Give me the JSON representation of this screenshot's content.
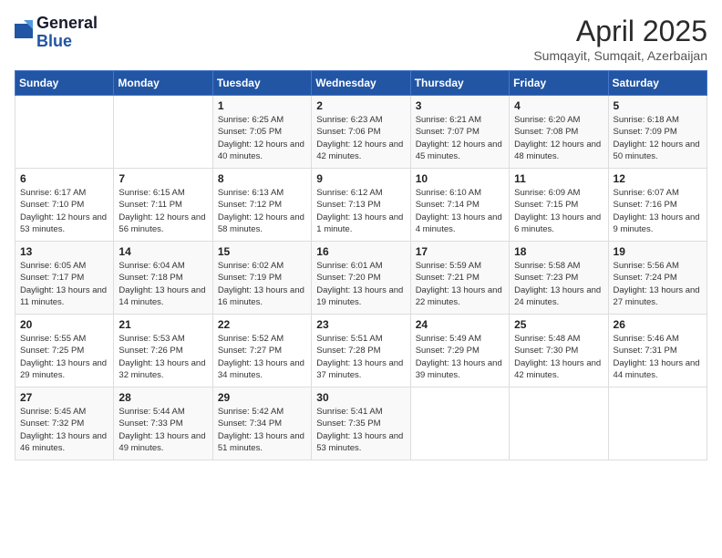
{
  "logo": {
    "general": "General",
    "blue": "Blue"
  },
  "title": "April 2025",
  "subtitle": "Sumqayit, Sumqait, Azerbaijan",
  "headers": [
    "Sunday",
    "Monday",
    "Tuesday",
    "Wednesday",
    "Thursday",
    "Friday",
    "Saturday"
  ],
  "weeks": [
    [
      {
        "day": "",
        "info": ""
      },
      {
        "day": "",
        "info": ""
      },
      {
        "day": "1",
        "info": "Sunrise: 6:25 AM\nSunset: 7:05 PM\nDaylight: 12 hours and 40 minutes."
      },
      {
        "day": "2",
        "info": "Sunrise: 6:23 AM\nSunset: 7:06 PM\nDaylight: 12 hours and 42 minutes."
      },
      {
        "day": "3",
        "info": "Sunrise: 6:21 AM\nSunset: 7:07 PM\nDaylight: 12 hours and 45 minutes."
      },
      {
        "day": "4",
        "info": "Sunrise: 6:20 AM\nSunset: 7:08 PM\nDaylight: 12 hours and 48 minutes."
      },
      {
        "day": "5",
        "info": "Sunrise: 6:18 AM\nSunset: 7:09 PM\nDaylight: 12 hours and 50 minutes."
      }
    ],
    [
      {
        "day": "6",
        "info": "Sunrise: 6:17 AM\nSunset: 7:10 PM\nDaylight: 12 hours and 53 minutes."
      },
      {
        "day": "7",
        "info": "Sunrise: 6:15 AM\nSunset: 7:11 PM\nDaylight: 12 hours and 56 minutes."
      },
      {
        "day": "8",
        "info": "Sunrise: 6:13 AM\nSunset: 7:12 PM\nDaylight: 12 hours and 58 minutes."
      },
      {
        "day": "9",
        "info": "Sunrise: 6:12 AM\nSunset: 7:13 PM\nDaylight: 13 hours and 1 minute."
      },
      {
        "day": "10",
        "info": "Sunrise: 6:10 AM\nSunset: 7:14 PM\nDaylight: 13 hours and 4 minutes."
      },
      {
        "day": "11",
        "info": "Sunrise: 6:09 AM\nSunset: 7:15 PM\nDaylight: 13 hours and 6 minutes."
      },
      {
        "day": "12",
        "info": "Sunrise: 6:07 AM\nSunset: 7:16 PM\nDaylight: 13 hours and 9 minutes."
      }
    ],
    [
      {
        "day": "13",
        "info": "Sunrise: 6:05 AM\nSunset: 7:17 PM\nDaylight: 13 hours and 11 minutes."
      },
      {
        "day": "14",
        "info": "Sunrise: 6:04 AM\nSunset: 7:18 PM\nDaylight: 13 hours and 14 minutes."
      },
      {
        "day": "15",
        "info": "Sunrise: 6:02 AM\nSunset: 7:19 PM\nDaylight: 13 hours and 16 minutes."
      },
      {
        "day": "16",
        "info": "Sunrise: 6:01 AM\nSunset: 7:20 PM\nDaylight: 13 hours and 19 minutes."
      },
      {
        "day": "17",
        "info": "Sunrise: 5:59 AM\nSunset: 7:21 PM\nDaylight: 13 hours and 22 minutes."
      },
      {
        "day": "18",
        "info": "Sunrise: 5:58 AM\nSunset: 7:23 PM\nDaylight: 13 hours and 24 minutes."
      },
      {
        "day": "19",
        "info": "Sunrise: 5:56 AM\nSunset: 7:24 PM\nDaylight: 13 hours and 27 minutes."
      }
    ],
    [
      {
        "day": "20",
        "info": "Sunrise: 5:55 AM\nSunset: 7:25 PM\nDaylight: 13 hours and 29 minutes."
      },
      {
        "day": "21",
        "info": "Sunrise: 5:53 AM\nSunset: 7:26 PM\nDaylight: 13 hours and 32 minutes."
      },
      {
        "day": "22",
        "info": "Sunrise: 5:52 AM\nSunset: 7:27 PM\nDaylight: 13 hours and 34 minutes."
      },
      {
        "day": "23",
        "info": "Sunrise: 5:51 AM\nSunset: 7:28 PM\nDaylight: 13 hours and 37 minutes."
      },
      {
        "day": "24",
        "info": "Sunrise: 5:49 AM\nSunset: 7:29 PM\nDaylight: 13 hours and 39 minutes."
      },
      {
        "day": "25",
        "info": "Sunrise: 5:48 AM\nSunset: 7:30 PM\nDaylight: 13 hours and 42 minutes."
      },
      {
        "day": "26",
        "info": "Sunrise: 5:46 AM\nSunset: 7:31 PM\nDaylight: 13 hours and 44 minutes."
      }
    ],
    [
      {
        "day": "27",
        "info": "Sunrise: 5:45 AM\nSunset: 7:32 PM\nDaylight: 13 hours and 46 minutes."
      },
      {
        "day": "28",
        "info": "Sunrise: 5:44 AM\nSunset: 7:33 PM\nDaylight: 13 hours and 49 minutes."
      },
      {
        "day": "29",
        "info": "Sunrise: 5:42 AM\nSunset: 7:34 PM\nDaylight: 13 hours and 51 minutes."
      },
      {
        "day": "30",
        "info": "Sunrise: 5:41 AM\nSunset: 7:35 PM\nDaylight: 13 hours and 53 minutes."
      },
      {
        "day": "",
        "info": ""
      },
      {
        "day": "",
        "info": ""
      },
      {
        "day": "",
        "info": ""
      }
    ]
  ]
}
